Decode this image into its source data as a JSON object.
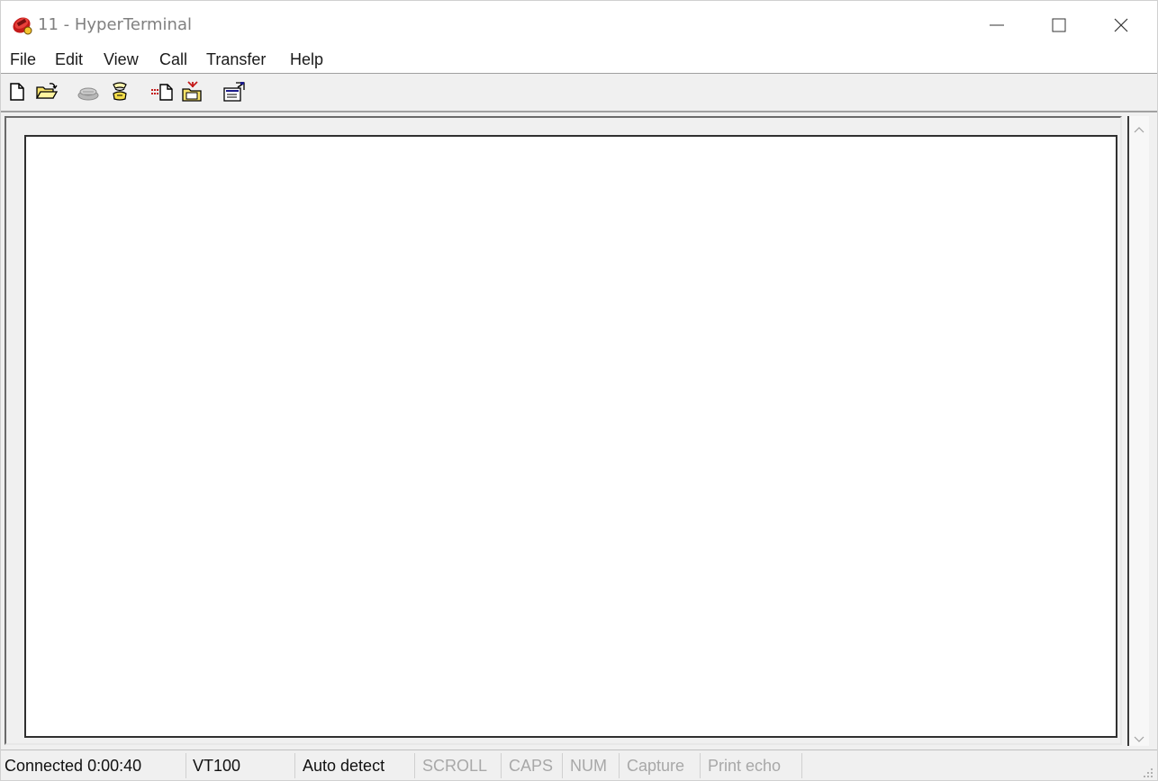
{
  "window": {
    "title": "11 - HyperTerminal"
  },
  "menu": {
    "items": [
      "File",
      "Edit",
      "View",
      "Call",
      "Transfer",
      "Help"
    ]
  },
  "toolbar": {
    "icons": [
      "new-icon",
      "open-icon",
      "disconnect-icon",
      "dial-icon",
      "send-icon",
      "receive-icon",
      "properties-icon"
    ]
  },
  "statusbar": {
    "connection": "Connected 0:00:40",
    "emulation": "VT100",
    "detect": "Auto detect",
    "scroll": "SCROLL",
    "caps": "CAPS",
    "num": "NUM",
    "capture": "Capture",
    "print_echo": "Print echo"
  },
  "colors": {
    "accent_red": "#c41a1a",
    "toolbar_bg": "#f0f0f0",
    "dim_text": "#a8a8a8"
  }
}
